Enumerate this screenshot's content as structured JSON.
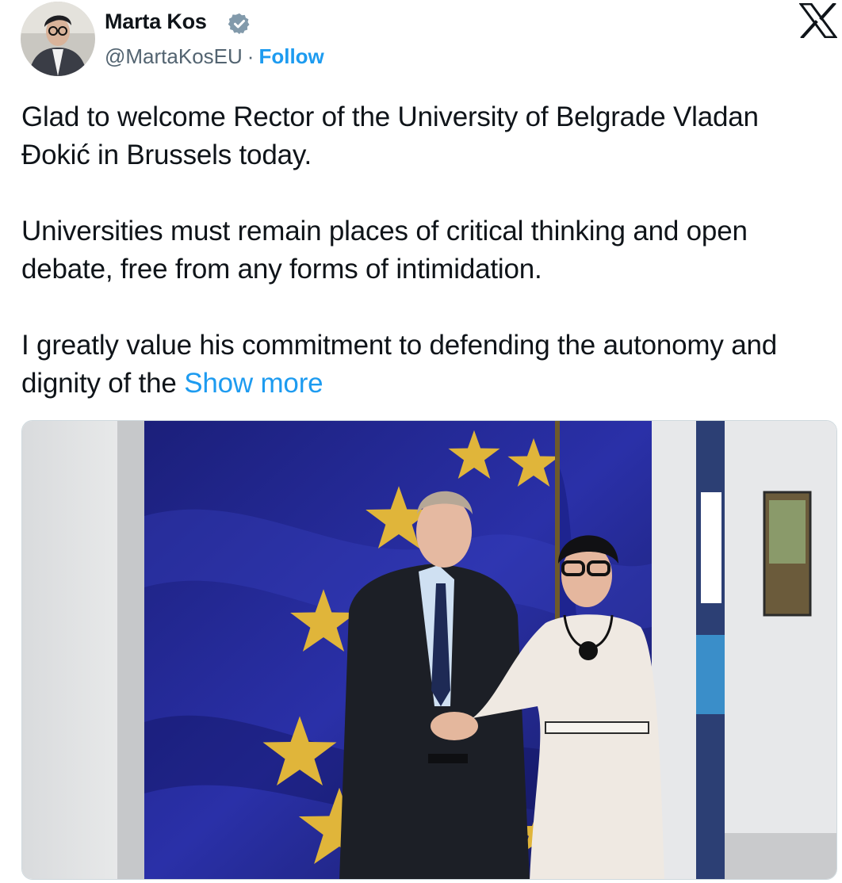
{
  "author": {
    "display_name": "Marta Kos",
    "verified_icon": "verified-badge-icon",
    "handle": "@MartaKosEU",
    "separator": "·",
    "follow_label": "Follow"
  },
  "brand_icon": "x-logo-icon",
  "tweet": {
    "paragraph_1": "Glad to welcome Rector of the University of Belgrade Vladan Đokić in Brussels today.",
    "paragraph_2": "Universities must remain places of critical thinking and open debate, free from any forms of intimidation.",
    "paragraph_3": "I greatly value his commitment to defending the autonomy and dignity of the",
    "show_more_label": "Show more"
  },
  "media": {
    "type": "photo"
  },
  "colors": {
    "accent": "#1d9bf0",
    "text": "#0f1419",
    "secondary_text": "#536471",
    "verified": "#829aab"
  }
}
